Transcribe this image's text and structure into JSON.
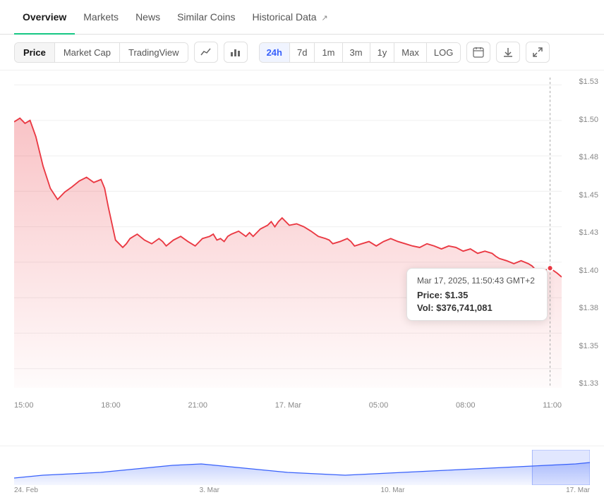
{
  "nav": {
    "tabs": [
      {
        "id": "overview",
        "label": "Overview",
        "active": true,
        "ext": false
      },
      {
        "id": "markets",
        "label": "Markets",
        "active": false,
        "ext": false
      },
      {
        "id": "news",
        "label": "News",
        "active": false,
        "ext": false
      },
      {
        "id": "similar-coins",
        "label": "Similar Coins",
        "active": false,
        "ext": false
      },
      {
        "id": "historical-data",
        "label": "Historical Data",
        "active": false,
        "ext": true
      }
    ]
  },
  "chart_controls": {
    "view_buttons": [
      {
        "id": "price",
        "label": "Price",
        "active": true
      },
      {
        "id": "market-cap",
        "label": "Market Cap",
        "active": false
      },
      {
        "id": "trading-view",
        "label": "TradingView",
        "active": false
      }
    ],
    "icon_buttons": [
      {
        "id": "line-chart",
        "label": "📈",
        "icon": "line-chart-icon"
      },
      {
        "id": "bar-chart",
        "label": "📊",
        "icon": "bar-chart-icon"
      }
    ],
    "time_buttons": [
      {
        "id": "24h",
        "label": "24h",
        "active": true
      },
      {
        "id": "7d",
        "label": "7d",
        "active": false
      },
      {
        "id": "1m",
        "label": "1m",
        "active": false
      },
      {
        "id": "3m",
        "label": "3m",
        "active": false
      },
      {
        "id": "1y",
        "label": "1y",
        "active": false
      },
      {
        "id": "max",
        "label": "Max",
        "active": false
      },
      {
        "id": "log",
        "label": "LOG",
        "active": false
      }
    ],
    "action_buttons": [
      {
        "id": "calendar",
        "label": "📅",
        "icon": "calendar-icon"
      },
      {
        "id": "download",
        "label": "⬇",
        "icon": "download-icon"
      },
      {
        "id": "expand",
        "label": "⤢",
        "icon": "expand-icon"
      }
    ]
  },
  "y_axis": {
    "labels": [
      "$1.53",
      "$1.50",
      "$1.48",
      "$1.45",
      "$1.43",
      "$1.40",
      "$1.38",
      "$1.35",
      "$1.33"
    ]
  },
  "x_axis": {
    "labels": [
      "15:00",
      "18:00",
      "21:00",
      "17. Mar",
      "05:00",
      "08:00",
      "11:00"
    ]
  },
  "tooltip": {
    "date": "Mar 17, 2025, 11:50:43 GMT+2",
    "price_label": "Price:",
    "price_value": "$1.35",
    "vol_label": "Vol:",
    "vol_value": "$376,741,081"
  },
  "minimap": {
    "x_labels": [
      "24. Feb",
      "3. Mar",
      "10. Mar",
      "17. Mar"
    ]
  },
  "colors": {
    "accent_green": "#16c784",
    "accent_blue": "#3861fb",
    "chart_red": "#ea3943",
    "chart_red_fill": "rgba(234,57,67,0.15)"
  }
}
